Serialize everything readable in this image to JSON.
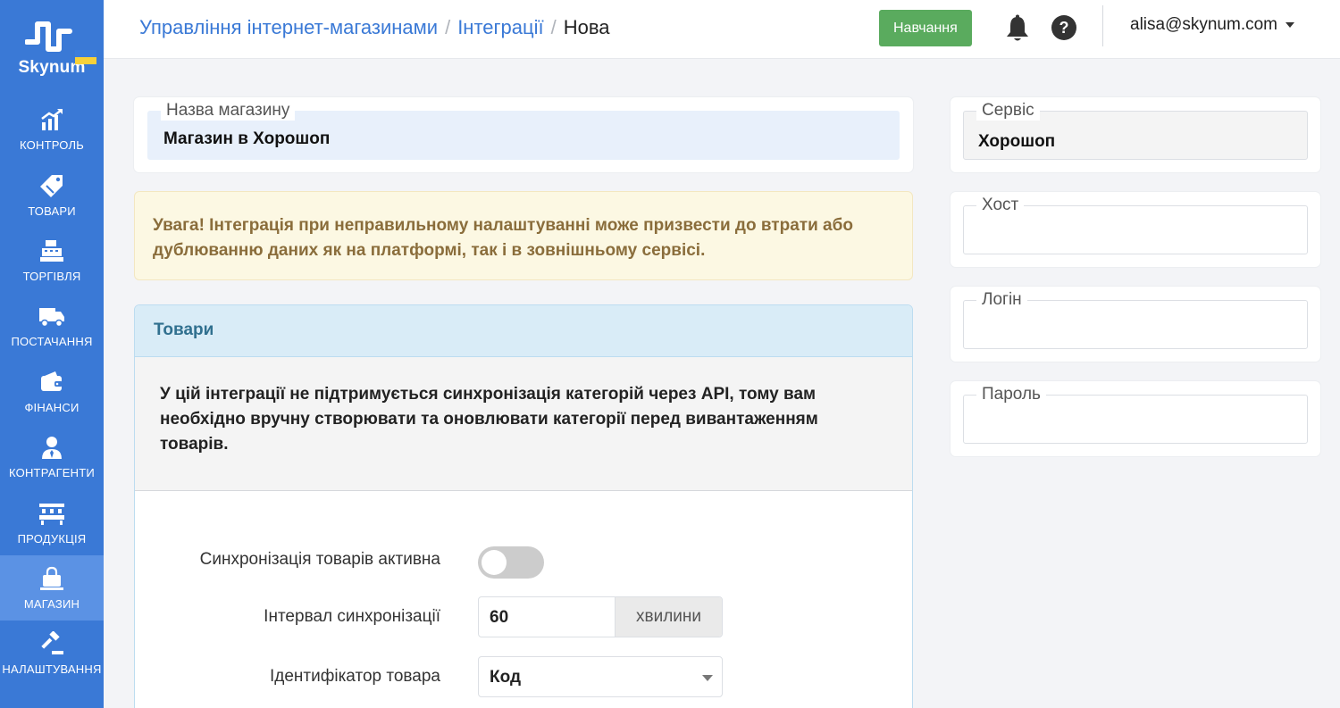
{
  "brand": {
    "name": "Skynum"
  },
  "sidebar": {
    "items": [
      {
        "label": "КОНТРОЛЬ",
        "icon": "chart-up-icon"
      },
      {
        "label": "ТОВАРИ",
        "icon": "tags-icon"
      },
      {
        "label": "ТОРГІВЛЯ",
        "icon": "cash-register-icon"
      },
      {
        "label": "ПОСТАЧАННЯ",
        "icon": "truck-icon"
      },
      {
        "label": "ФІНАНСИ",
        "icon": "wallet-icon"
      },
      {
        "label": "КОНТРАГЕНТИ",
        "icon": "user-tie-icon"
      },
      {
        "label": "ПРОДУКЦІЯ",
        "icon": "industry-icon"
      },
      {
        "label": "МАГАЗИН",
        "icon": "shopping-bag-icon",
        "active": true
      },
      {
        "label": "НАЛАШТУВАННЯ",
        "icon": "gavel-icon"
      }
    ]
  },
  "header": {
    "breadcrumb": [
      "Управління інтернет-магазинами",
      "Інтеграції",
      "Нова"
    ],
    "learn_button": "Навчання",
    "user_email": "alisa@skynum.com"
  },
  "shop": {
    "label": "Назва магазину",
    "value": "Магазин в Хорошоп"
  },
  "alert": {
    "text": "Увага! Інтеграція при неправильному налаштуванні може призвести до втрати або дублюванню даних як на платформі, так і в зовнішньому сервісі."
  },
  "products_panel": {
    "title": "Товари",
    "note": "У цій інтеграції не підтримується синхронізація категорій через API, тому вам необхідно вручну створювати та оновлювати категорії перед вивантаженням товарів.",
    "sync_active_label": "Синхронізація товарів активна",
    "sync_active": false,
    "interval_label": "Інтервал синхронізації",
    "interval_value": "60",
    "interval_unit": "хвилини",
    "identifier_label": "Ідентифікатор товара",
    "identifier_value": "Код"
  },
  "right": {
    "service": {
      "label": "Сервіс",
      "value": "Хорошоп"
    },
    "host": {
      "label": "Хост",
      "value": ""
    },
    "login": {
      "label": "Логін",
      "value": ""
    },
    "password": {
      "label": "Пароль",
      "value": ""
    }
  },
  "colors": {
    "sidebar": "#3a79d6",
    "sidebar_active": "#5b92e4",
    "link": "#3a79d6",
    "learn_button": "#5aab5e",
    "alert_bg": "#fcf8e3",
    "alert_text": "#8a6d3b",
    "panel_head_bg": "#d9ecf7",
    "panel_head_text": "#31708f"
  }
}
